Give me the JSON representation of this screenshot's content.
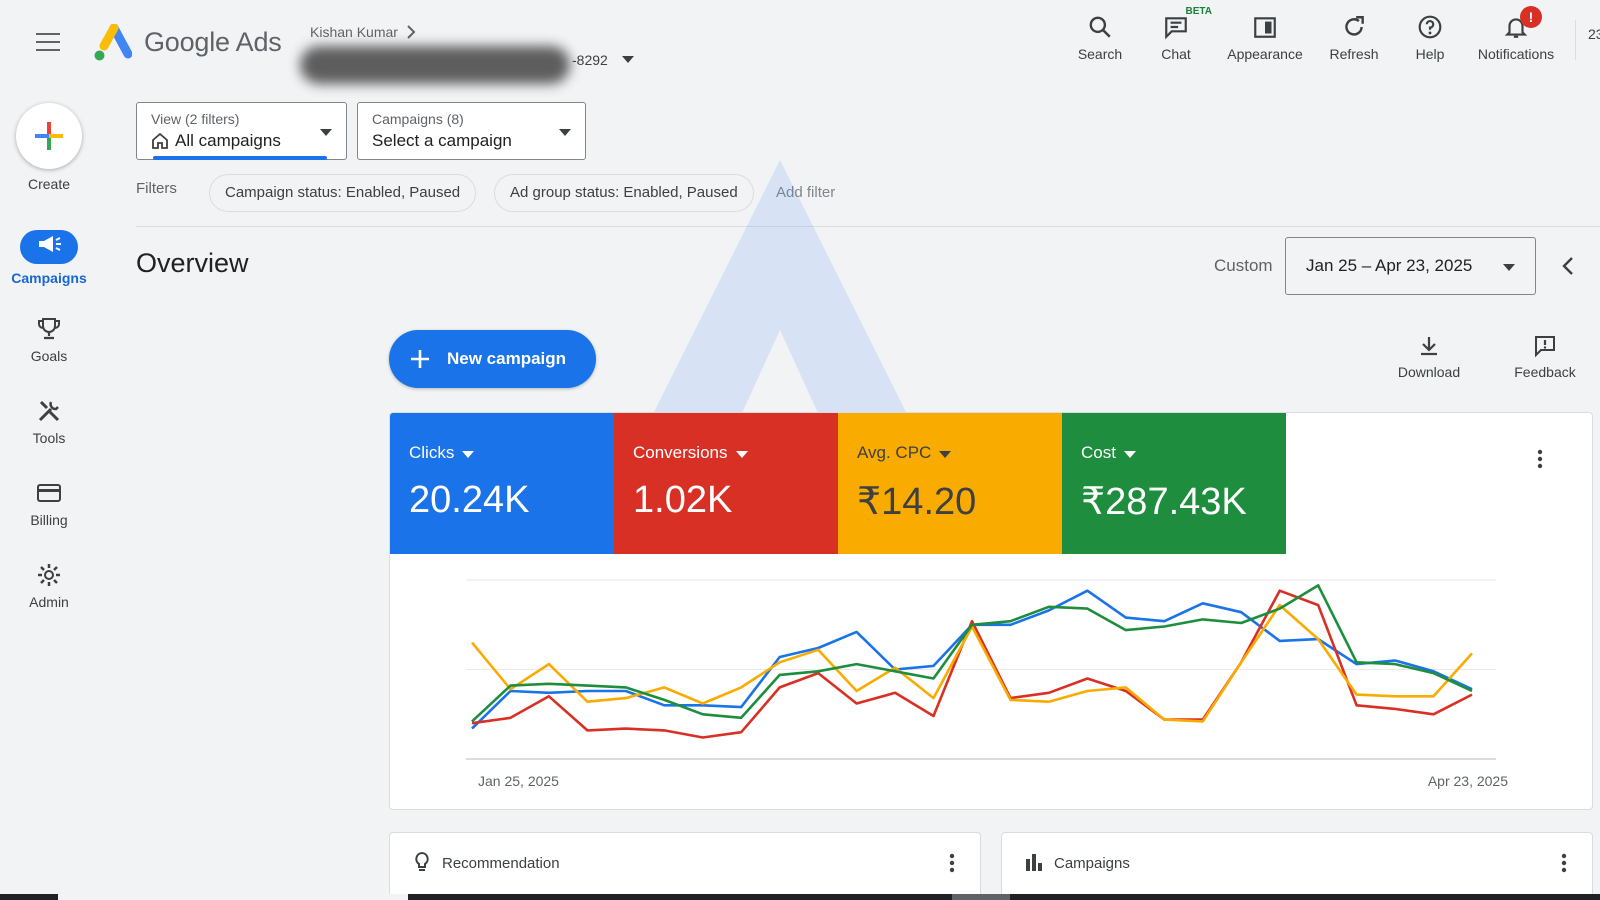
{
  "header": {
    "brand": "Google Ads",
    "account_name": "Kishan Kumar",
    "account_id_visible": "-8292",
    "actions": [
      {
        "label": "Search",
        "icon": "search-icon"
      },
      {
        "label": "Chat",
        "icon": "chat-icon",
        "badge": "BETA"
      },
      {
        "label": "Appearance",
        "icon": "appearance-icon"
      },
      {
        "label": "Refresh",
        "icon": "refresh-icon"
      },
      {
        "label": "Help",
        "icon": "help-icon"
      },
      {
        "label": "Notifications",
        "icon": "bell-icon",
        "badge": "!"
      }
    ],
    "cut_text": "23"
  },
  "nav": {
    "create": "Create",
    "items": [
      {
        "label": "Campaigns",
        "icon": "megaphone-icon",
        "active": true
      },
      {
        "label": "Goals",
        "icon": "trophy-icon"
      },
      {
        "label": "Tools",
        "icon": "tools-icon"
      },
      {
        "label": "Billing",
        "icon": "credit-card-icon"
      },
      {
        "label": "Admin",
        "icon": "gear-icon"
      }
    ]
  },
  "view_select": {
    "label": "View (2 filters)",
    "value": "All campaigns"
  },
  "campaign_select": {
    "label": "Campaigns (8)",
    "value": "Select a campaign"
  },
  "filters": {
    "label": "Filters",
    "chips": [
      "Campaign status: Enabled, Paused",
      "Ad group status: Enabled, Paused"
    ],
    "add": "Add filter"
  },
  "overview": {
    "title": "Overview",
    "range_label": "Custom",
    "date_range": "Jan 25 – Apr 23, 2025",
    "new_campaign": "New campaign",
    "download": "Download",
    "feedback": "Feedback"
  },
  "metrics": [
    {
      "label": "Clicks",
      "value": "20.24K",
      "color": "#1a73e8",
      "text": "#ffffff"
    },
    {
      "label": "Conversions",
      "value": "1.02K",
      "color": "#d93025",
      "text": "#ffffff"
    },
    {
      "label": "Avg. CPC",
      "value": "₹14.20",
      "color": "#f9ab00",
      "text": "#3c4043"
    },
    {
      "label": "Cost",
      "value": "₹287.43K",
      "color": "#1e8e3e",
      "text": "#ffffff"
    }
  ],
  "chart_data": {
    "type": "line",
    "x_start_label": "Jan 25, 2025",
    "x_end_label": "Apr 23, 2025",
    "grid": true,
    "series": [
      {
        "name": "Clicks",
        "color": "#1a73e8",
        "values": [
          0.17,
          0.38,
          0.37,
          0.38,
          0.38,
          0.3,
          0.3,
          0.29,
          0.57,
          0.62,
          0.71,
          0.5,
          0.52,
          0.75,
          0.75,
          0.83,
          0.94,
          0.79,
          0.77,
          0.87,
          0.82,
          0.66,
          0.67,
          0.53,
          0.55,
          0.49,
          0.39
        ]
      },
      {
        "name": "Conversions",
        "color": "#d93025",
        "values": [
          0.2,
          0.23,
          0.35,
          0.16,
          0.17,
          0.16,
          0.12,
          0.15,
          0.4,
          0.48,
          0.31,
          0.37,
          0.24,
          0.77,
          0.34,
          0.37,
          0.45,
          0.38,
          0.22,
          0.22,
          0.54,
          0.94,
          0.86,
          0.3,
          0.28,
          0.25,
          0.36
        ]
      },
      {
        "name": "Avg. CPC",
        "color": "#f9ab00",
        "values": [
          0.65,
          0.39,
          0.53,
          0.32,
          0.34,
          0.4,
          0.31,
          0.4,
          0.54,
          0.61,
          0.38,
          0.51,
          0.34,
          0.74,
          0.33,
          0.32,
          0.38,
          0.4,
          0.22,
          0.21,
          0.54,
          0.86,
          0.67,
          0.36,
          0.35,
          0.35,
          0.59
        ]
      },
      {
        "name": "Cost",
        "color": "#1e8e3e",
        "values": [
          0.21,
          0.41,
          0.42,
          0.41,
          0.4,
          0.33,
          0.25,
          0.23,
          0.47,
          0.49,
          0.53,
          0.49,
          0.45,
          0.75,
          0.77,
          0.85,
          0.84,
          0.72,
          0.74,
          0.78,
          0.76,
          0.84,
          0.97,
          0.54,
          0.53,
          0.48,
          0.38
        ]
      }
    ]
  },
  "cards": [
    {
      "title": "Recommendation",
      "icon": "lightbulb-icon"
    },
    {
      "title": "Campaigns",
      "icon": "bar-chart-icon"
    }
  ]
}
